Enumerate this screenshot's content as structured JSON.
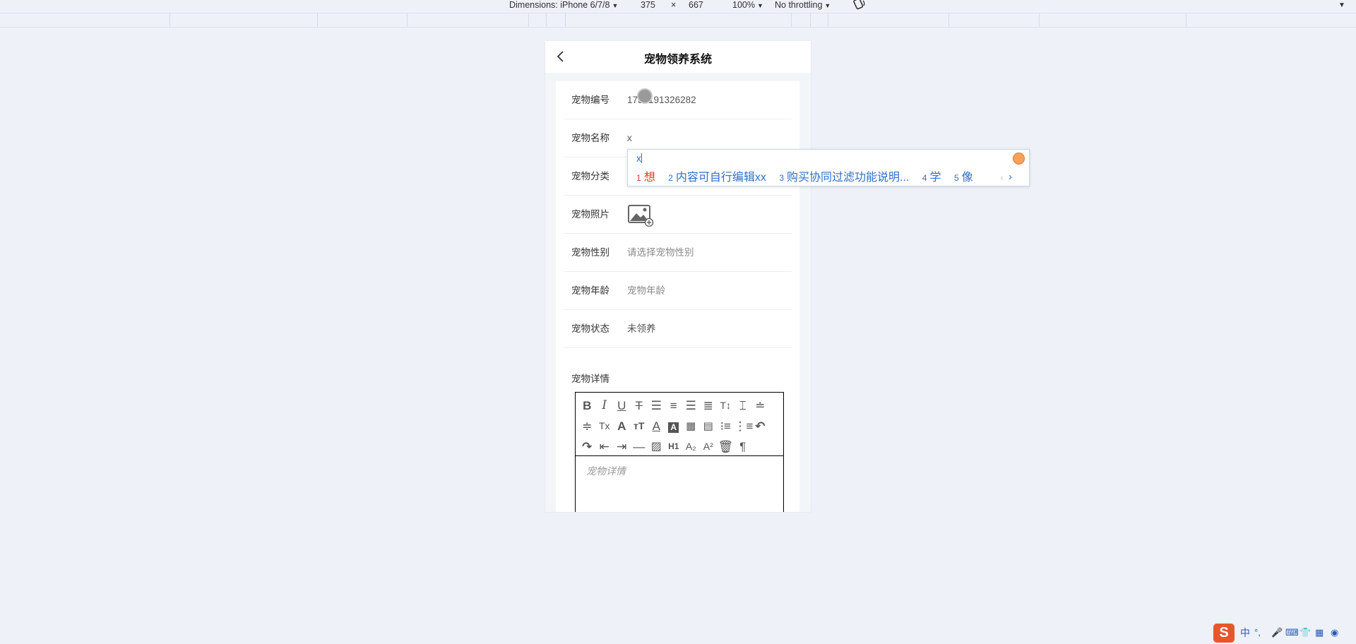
{
  "devtools": {
    "dimensions_label": "Dimensions: iPhone 6/7/8",
    "width": "375",
    "times": "×",
    "height": "667",
    "zoom": "100%",
    "throttling": "No throttling"
  },
  "header": {
    "title": "宠物领养系统"
  },
  "form": {
    "pet_id": {
      "label": "宠物编号",
      "value": "1730191326282"
    },
    "pet_name": {
      "label": "宠物名称",
      "value": "x"
    },
    "pet_category": {
      "label": "宠物分类"
    },
    "pet_photo": {
      "label": "宠物照片"
    },
    "pet_gender": {
      "label": "宠物性别",
      "placeholder": "请选择宠物性别"
    },
    "pet_age": {
      "label": "宠物年龄",
      "placeholder": "宠物年龄"
    },
    "pet_status": {
      "label": "宠物状态",
      "value": "未领养"
    },
    "pet_detail": {
      "label": "宠物详情",
      "placeholder": "宠物详情"
    }
  },
  "ime": {
    "input": "x",
    "candidates": [
      {
        "num": "1",
        "text": "想"
      },
      {
        "num": "2",
        "text": "内容可自行编辑xx"
      },
      {
        "num": "3",
        "text": "购买协同过滤功能说明..."
      },
      {
        "num": "4",
        "text": "学"
      },
      {
        "num": "5",
        "text": "像"
      }
    ]
  },
  "tray": {
    "logo": "S",
    "lang": "中"
  },
  "colors": {
    "page_bg": "#eef1f8",
    "ime_accent": "#2f6fc7",
    "ime_first": "#e23b2c",
    "sogou": "#e9562b"
  }
}
